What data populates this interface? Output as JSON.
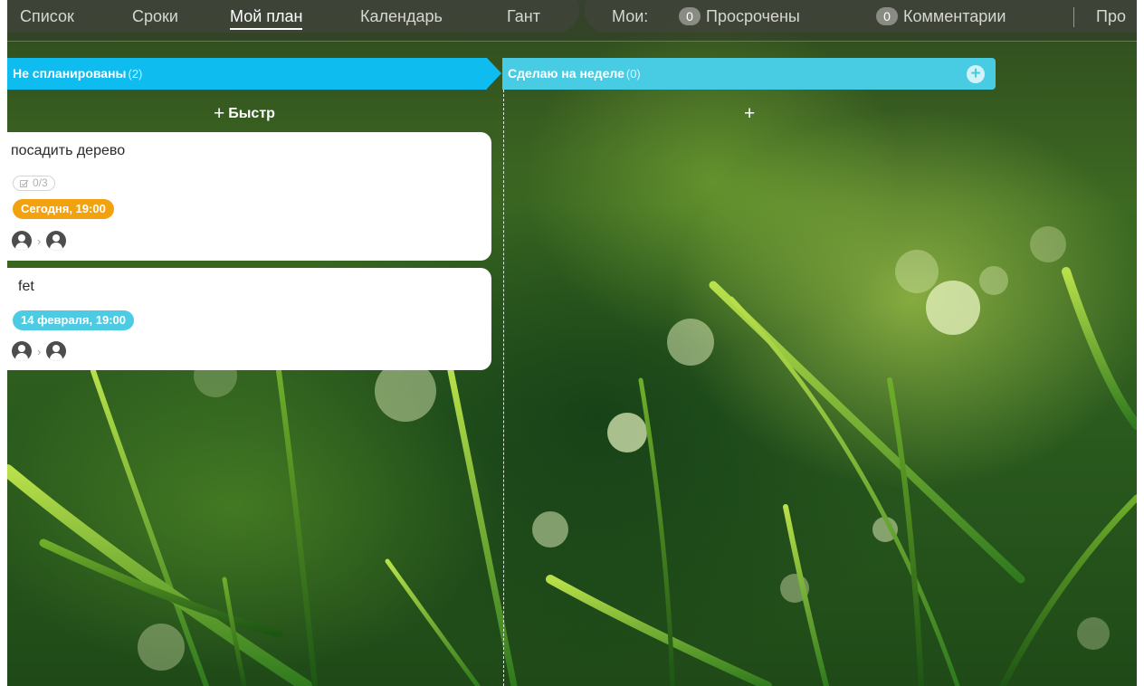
{
  "nav": {
    "tabs": [
      {
        "label": "Список",
        "active": false
      },
      {
        "label": "Сроки",
        "active": false
      },
      {
        "label": "Мой план",
        "active": true
      },
      {
        "label": "Календарь",
        "active": false
      },
      {
        "label": "Гант",
        "active": false
      }
    ],
    "mine_label": "Мои:",
    "overdue": {
      "count": "0",
      "label": "Просрочены"
    },
    "comments": {
      "count": "0",
      "label": "Комментарии"
    },
    "truncated_label": "Про"
  },
  "columns": [
    {
      "title": "Не спланированы",
      "count": "(2)",
      "color": "#0fbcf0",
      "quick_add_label": "Быстр",
      "add_icon": "plus-icon"
    },
    {
      "title": "Сделаю на неделе",
      "count": "(0)",
      "color": "#47cce3",
      "add_icon": "plus-circle-icon"
    }
  ],
  "cards": [
    {
      "title": "посадить дерево",
      "checklist": "0/3",
      "checklist_icon": "checklist-icon",
      "due": "Сегодня, 19:00",
      "due_color": "#f3a20f"
    },
    {
      "title": "fet",
      "due": "14 февраля, 19:00",
      "due_color": "#4dcbe3"
    }
  ],
  "icons": {
    "avatar": "user-avatar-icon",
    "arrow": "chevron-right-icon"
  },
  "glyphs": {
    "plus": "+",
    "chevron": "›"
  }
}
